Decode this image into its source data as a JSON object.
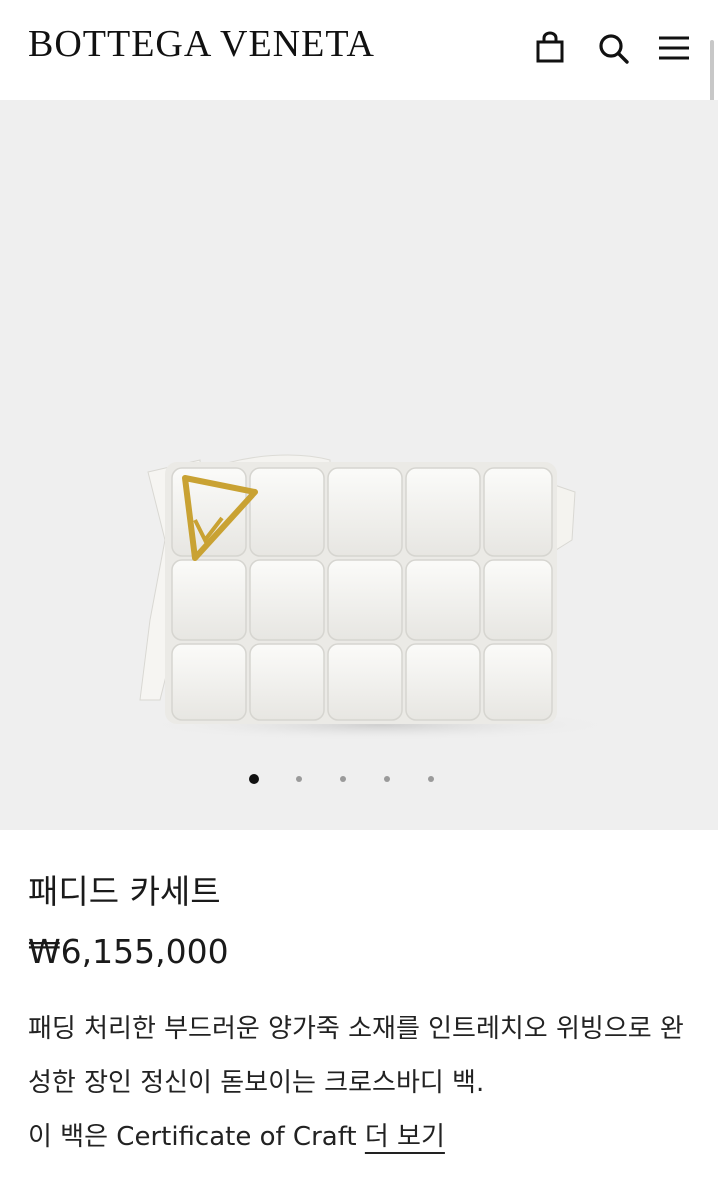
{
  "header": {
    "brand": "BOTTEGA VENETA",
    "icons": [
      "bag-icon",
      "search-icon",
      "menu-icon"
    ]
  },
  "gallery": {
    "image": "white woven padded crossbody bag with gold triangle clasp",
    "dot_count": 5,
    "active_index": 0
  },
  "product": {
    "name": "패디드 카세트",
    "price": "₩6,155,000",
    "description": "패딩 처리한 부드러운 양가죽 소재를 인트레치오 위빙으로 완성한 장인 정신이 돋보이는 크로스바디 백.",
    "certificate_text": "이 백은 Certificate of Craft",
    "more_label": "더 보기"
  },
  "colors": {
    "text": "#1a1a1a",
    "hero_background": "#efefef",
    "clasp_gold": "#c9a233"
  }
}
